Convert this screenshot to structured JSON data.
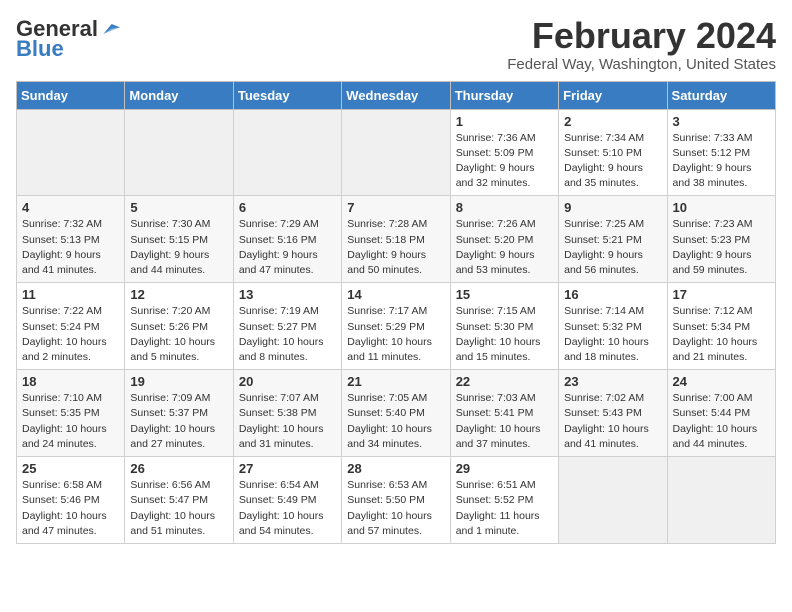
{
  "logo": {
    "part1": "General",
    "part2": "Blue"
  },
  "header": {
    "month": "February 2024",
    "location": "Federal Way, Washington, United States"
  },
  "weekdays": [
    "Sunday",
    "Monday",
    "Tuesday",
    "Wednesday",
    "Thursday",
    "Friday",
    "Saturday"
  ],
  "weeks": [
    [
      {
        "day": "",
        "info": ""
      },
      {
        "day": "",
        "info": ""
      },
      {
        "day": "",
        "info": ""
      },
      {
        "day": "",
        "info": ""
      },
      {
        "day": "1",
        "info": "Sunrise: 7:36 AM\nSunset: 5:09 PM\nDaylight: 9 hours\nand 32 minutes."
      },
      {
        "day": "2",
        "info": "Sunrise: 7:34 AM\nSunset: 5:10 PM\nDaylight: 9 hours\nand 35 minutes."
      },
      {
        "day": "3",
        "info": "Sunrise: 7:33 AM\nSunset: 5:12 PM\nDaylight: 9 hours\nand 38 minutes."
      }
    ],
    [
      {
        "day": "4",
        "info": "Sunrise: 7:32 AM\nSunset: 5:13 PM\nDaylight: 9 hours\nand 41 minutes."
      },
      {
        "day": "5",
        "info": "Sunrise: 7:30 AM\nSunset: 5:15 PM\nDaylight: 9 hours\nand 44 minutes."
      },
      {
        "day": "6",
        "info": "Sunrise: 7:29 AM\nSunset: 5:16 PM\nDaylight: 9 hours\nand 47 minutes."
      },
      {
        "day": "7",
        "info": "Sunrise: 7:28 AM\nSunset: 5:18 PM\nDaylight: 9 hours\nand 50 minutes."
      },
      {
        "day": "8",
        "info": "Sunrise: 7:26 AM\nSunset: 5:20 PM\nDaylight: 9 hours\nand 53 minutes."
      },
      {
        "day": "9",
        "info": "Sunrise: 7:25 AM\nSunset: 5:21 PM\nDaylight: 9 hours\nand 56 minutes."
      },
      {
        "day": "10",
        "info": "Sunrise: 7:23 AM\nSunset: 5:23 PM\nDaylight: 9 hours\nand 59 minutes."
      }
    ],
    [
      {
        "day": "11",
        "info": "Sunrise: 7:22 AM\nSunset: 5:24 PM\nDaylight: 10 hours\nand 2 minutes."
      },
      {
        "day": "12",
        "info": "Sunrise: 7:20 AM\nSunset: 5:26 PM\nDaylight: 10 hours\nand 5 minutes."
      },
      {
        "day": "13",
        "info": "Sunrise: 7:19 AM\nSunset: 5:27 PM\nDaylight: 10 hours\nand 8 minutes."
      },
      {
        "day": "14",
        "info": "Sunrise: 7:17 AM\nSunset: 5:29 PM\nDaylight: 10 hours\nand 11 minutes."
      },
      {
        "day": "15",
        "info": "Sunrise: 7:15 AM\nSunset: 5:30 PM\nDaylight: 10 hours\nand 15 minutes."
      },
      {
        "day": "16",
        "info": "Sunrise: 7:14 AM\nSunset: 5:32 PM\nDaylight: 10 hours\nand 18 minutes."
      },
      {
        "day": "17",
        "info": "Sunrise: 7:12 AM\nSunset: 5:34 PM\nDaylight: 10 hours\nand 21 minutes."
      }
    ],
    [
      {
        "day": "18",
        "info": "Sunrise: 7:10 AM\nSunset: 5:35 PM\nDaylight: 10 hours\nand 24 minutes."
      },
      {
        "day": "19",
        "info": "Sunrise: 7:09 AM\nSunset: 5:37 PM\nDaylight: 10 hours\nand 27 minutes."
      },
      {
        "day": "20",
        "info": "Sunrise: 7:07 AM\nSunset: 5:38 PM\nDaylight: 10 hours\nand 31 minutes."
      },
      {
        "day": "21",
        "info": "Sunrise: 7:05 AM\nSunset: 5:40 PM\nDaylight: 10 hours\nand 34 minutes."
      },
      {
        "day": "22",
        "info": "Sunrise: 7:03 AM\nSunset: 5:41 PM\nDaylight: 10 hours\nand 37 minutes."
      },
      {
        "day": "23",
        "info": "Sunrise: 7:02 AM\nSunset: 5:43 PM\nDaylight: 10 hours\nand 41 minutes."
      },
      {
        "day": "24",
        "info": "Sunrise: 7:00 AM\nSunset: 5:44 PM\nDaylight: 10 hours\nand 44 minutes."
      }
    ],
    [
      {
        "day": "25",
        "info": "Sunrise: 6:58 AM\nSunset: 5:46 PM\nDaylight: 10 hours\nand 47 minutes."
      },
      {
        "day": "26",
        "info": "Sunrise: 6:56 AM\nSunset: 5:47 PM\nDaylight: 10 hours\nand 51 minutes."
      },
      {
        "day": "27",
        "info": "Sunrise: 6:54 AM\nSunset: 5:49 PM\nDaylight: 10 hours\nand 54 minutes."
      },
      {
        "day": "28",
        "info": "Sunrise: 6:53 AM\nSunset: 5:50 PM\nDaylight: 10 hours\nand 57 minutes."
      },
      {
        "day": "29",
        "info": "Sunrise: 6:51 AM\nSunset: 5:52 PM\nDaylight: 11 hours\nand 1 minute."
      },
      {
        "day": "",
        "info": ""
      },
      {
        "day": "",
        "info": ""
      }
    ]
  ]
}
